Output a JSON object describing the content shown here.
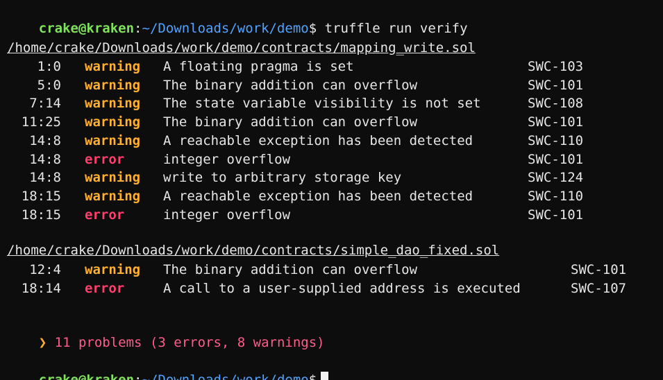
{
  "prompt_top": {
    "user_host": "crake@kraken",
    "colon": ":",
    "cwd": "~/Downloads/work/demo",
    "dollar": "$",
    "command": "truffle run verify"
  },
  "file1": {
    "path": "/home/crake/Downloads/work/demo/contracts/mapping_write.sol",
    "rows": [
      {
        "pos": "1:0",
        "severity": "warning",
        "message": "A floating pragma is set",
        "swc": "SWC-103"
      },
      {
        "pos": "5:0",
        "severity": "warning",
        "message": "The binary addition can overflow",
        "swc": "SWC-101"
      },
      {
        "pos": "7:14",
        "severity": "warning",
        "message": "The state variable visibility is not set",
        "swc": "SWC-108"
      },
      {
        "pos": "11:25",
        "severity": "warning",
        "message": "The binary addition can overflow",
        "swc": "SWC-101"
      },
      {
        "pos": "14:8",
        "severity": "warning",
        "message": "A reachable exception has been detected",
        "swc": "SWC-110"
      },
      {
        "pos": "14:8",
        "severity": "error",
        "message": "integer overflow",
        "swc": "SWC-101"
      },
      {
        "pos": "14:8",
        "severity": "warning",
        "message": "write to arbitrary storage key",
        "swc": "SWC-124"
      },
      {
        "pos": "18:15",
        "severity": "warning",
        "message": "A reachable exception has been detected",
        "swc": "SWC-110"
      },
      {
        "pos": "18:15",
        "severity": "error",
        "message": "integer overflow",
        "swc": "SWC-101"
      }
    ]
  },
  "file2": {
    "path": "/home/crake/Downloads/work/demo/contracts/simple_dao_fixed.sol",
    "rows": [
      {
        "pos": "12:4",
        "severity": "warning",
        "message": "The binary addition can overflow",
        "swc": "SWC-101"
      },
      {
        "pos": "18:14",
        "severity": "error",
        "message": "A call to a user-supplied address is executed",
        "swc": "SWC-107"
      }
    ]
  },
  "summary": {
    "arrow": "❯",
    "text": "11 problems (3 errors, 8 warnings)"
  },
  "prompt_bottom": {
    "user_host": "crake@kraken",
    "colon": ":",
    "cwd": "~/Downloads/work/demo",
    "dollar": "$"
  },
  "colors": {
    "background": "#0d0d0d",
    "user_host": "#7ee35a",
    "cwd": "#4fa3ff",
    "warning": "#ffb02e",
    "error": "#ff3f6e",
    "summary": "#ff5c8a"
  }
}
